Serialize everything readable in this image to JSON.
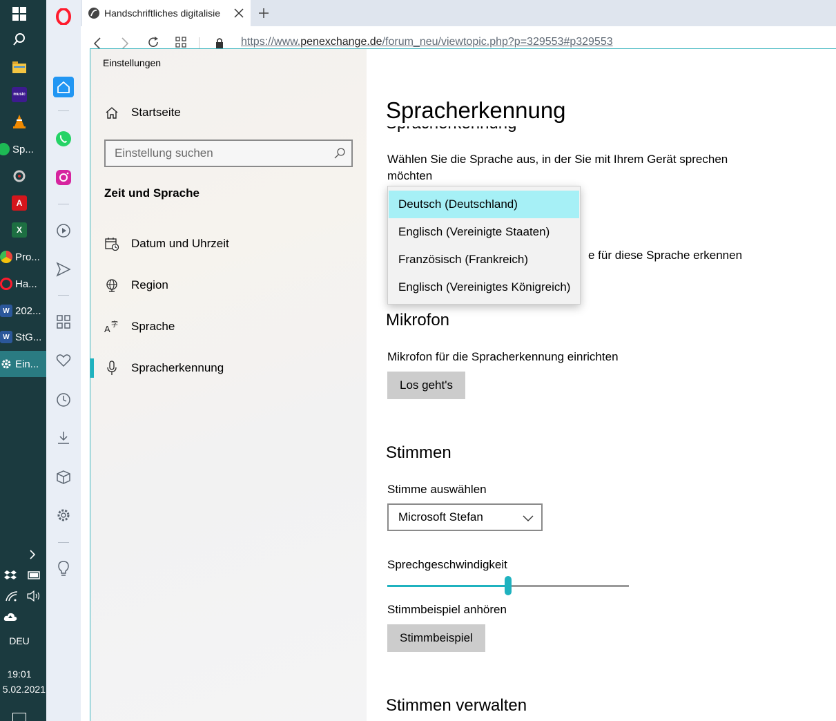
{
  "taskbar": {
    "apps": [
      {
        "label": "Sp...",
        "icon": "spotify-icon",
        "color": "#1db954"
      },
      {
        "label": "Pro...",
        "icon": "chrome-icon",
        "color": "#e8453c"
      },
      {
        "label": "Ha...",
        "icon": "opera-icon",
        "color": "#ff1b2d"
      },
      {
        "label": "202...",
        "icon": "word-icon",
        "color": "#2b579a"
      },
      {
        "label": "StG...",
        "icon": "word-icon",
        "color": "#2b579a"
      },
      {
        "label": "Ein...",
        "icon": "gear-icon",
        "color": "#ffffff"
      }
    ],
    "language": "DEU",
    "time": "19:01",
    "date": "5.02.2021"
  },
  "browser": {
    "tab_title": "Handschriftliches digitalisie",
    "url_prefix": "https://www.",
    "url_host": "penexchange.de",
    "url_path": "/forum_neu/viewtopic.php?p=329553#p329553"
  },
  "settings": {
    "window_title": "Einstellungen",
    "home_label": "Startseite",
    "search_placeholder": "Einstellung suchen",
    "section_title": "Zeit und Sprache",
    "nav_items": [
      {
        "label": "Datum und Uhrzeit",
        "icon": "calendar-clock-icon"
      },
      {
        "label": "Region",
        "icon": "globe-icon"
      },
      {
        "label": "Sprache",
        "icon": "language-icon"
      },
      {
        "label": "Spracherkennung",
        "icon": "microphone-icon"
      }
    ],
    "active_nav": "Spracherkennung"
  },
  "content": {
    "page_title": "Spracherkennung",
    "language_prompt": "Wählen Sie die Sprache aus, in der Sie mit Ihrem Gerät sprechen möchten",
    "accent_text_fragment": "e für diese Sprache erkennen",
    "language_options": [
      "Deutsch (Deutschland)",
      "Englisch (Vereinigte Staaten)",
      "Französisch (Frankreich)",
      "Englisch (Vereinigtes Königreich)"
    ],
    "selected_language": "Deutsch (Deutschland)",
    "mic_heading": "Mikrofon",
    "mic_text": "Mikrofon für die Spracherkennung einrichten",
    "mic_button": "Los geht's",
    "voices_heading": "Stimmen",
    "voice_select_label": "Stimme auswählen",
    "voice_selected": "Microsoft Stefan",
    "speed_label": "Sprechgeschwindigkeit",
    "speed_value": 0.5,
    "sample_label": "Stimmbeispiel anhören",
    "sample_button": "Stimmbeispiel",
    "manage_heading": "Stimmen verwalten"
  },
  "colors": {
    "accent": "#1fb2bf",
    "taskbar": "#1b3a3f",
    "selected_option": "#a6f0f6"
  }
}
